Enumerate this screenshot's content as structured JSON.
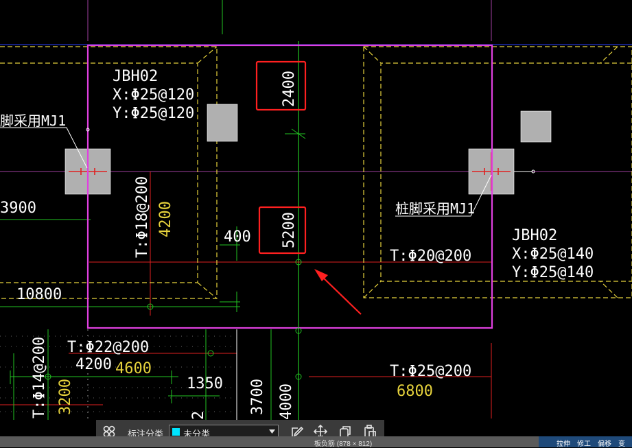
{
  "drawing": {
    "colors": {
      "background": "#000000",
      "slab_boundary": "#e040e0",
      "footing_dashed": "#e6d23c",
      "axis_green": "#22c322",
      "axis_red": "#e02020",
      "text_white": "#ffffff",
      "text_yellow": "#e6d23c",
      "highlight_box": "#ff2020",
      "arrow": "#ff2020",
      "column_fill": "#b0b0b0"
    },
    "labels": {
      "jbh_left_name": "JBH02",
      "jbh_left_x": "X:Φ25@120",
      "jbh_left_y": "Y:Φ25@120",
      "jbh_right_name": "JBH02",
      "jbh_right_x": "X:Φ25@140",
      "jbh_right_y": "Y:Φ25@140",
      "left_column_note": "脚采用MJ1",
      "right_column_note": "桩脚采用MJ1",
      "dim_3900": "3900",
      "dim_10800": "10800",
      "dim_400": "400",
      "dim_2400": "2400",
      "dim_5200": "5200",
      "rebar_t18": "T:Φ18@200",
      "dim_4200_yellow": "4200",
      "rebar_t20": "T:Φ20@200",
      "rebar_t22": "T:Φ22@200",
      "dim_4200_white": "4200",
      "dim_4600": "4600",
      "dim_1350": "1350",
      "rebar_t14": "T:Φ14@200",
      "dim_3200": "3200",
      "dim_3700": "3700",
      "dim_4000": "4000",
      "dim_partial_bottom": "2",
      "rebar_t25": "T:Φ25@200",
      "dim_6800": "6800"
    }
  },
  "toolbar": {
    "classify_label": "标注分类",
    "category_value": "未分类",
    "category_swatch": "#00e5ff"
  },
  "status": {
    "text": "板负筋 (878 × 812)"
  },
  "tool_strip": {
    "item1": "拉伸",
    "item2": "修工",
    "item3": "偏移",
    "item4": "变"
  }
}
